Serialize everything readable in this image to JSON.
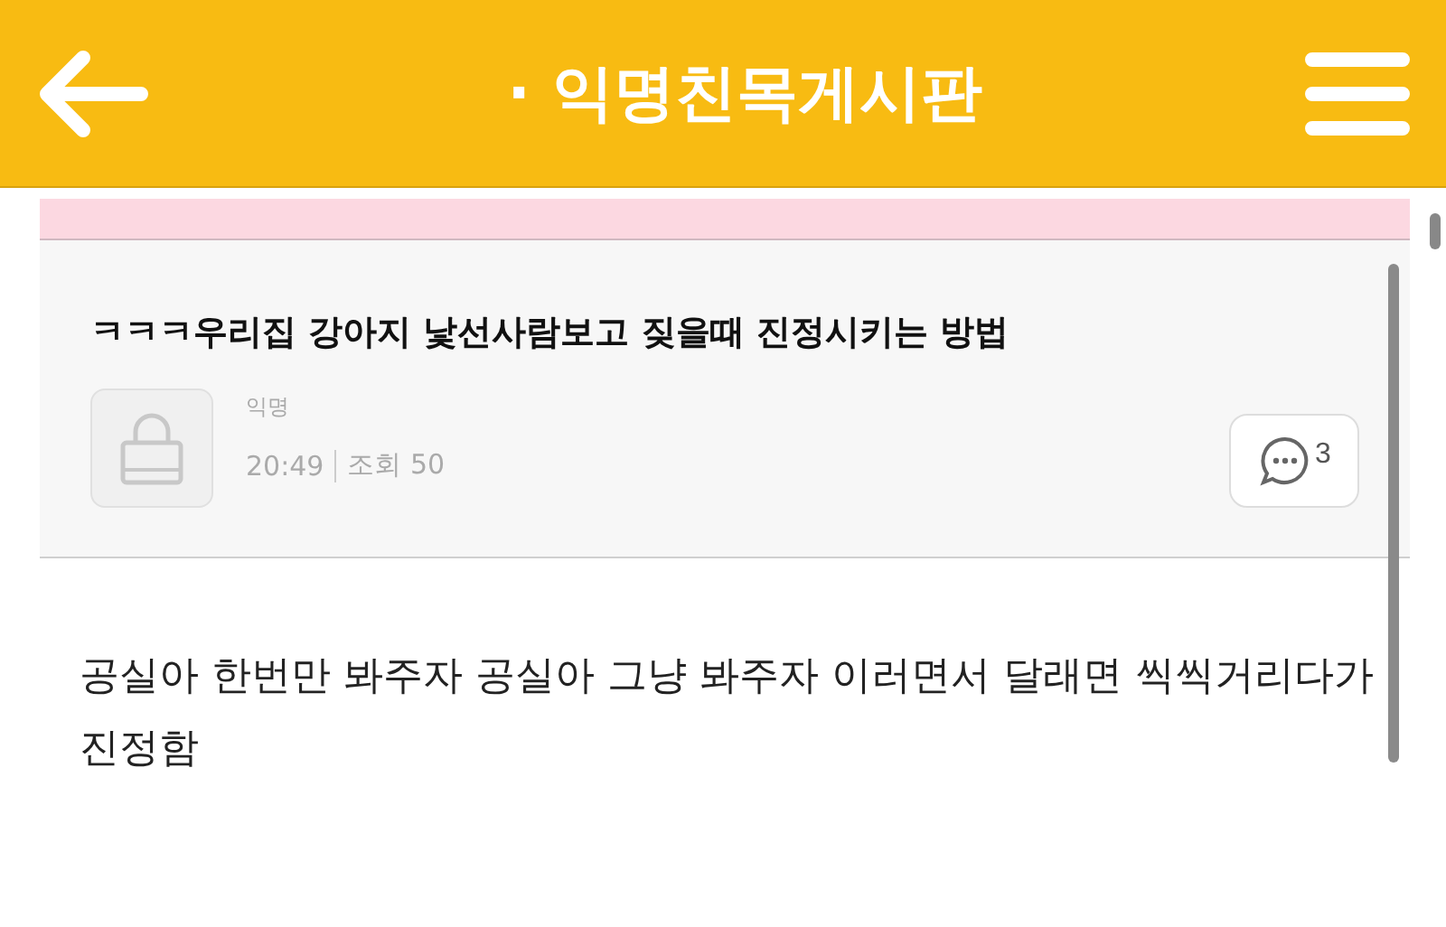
{
  "header": {
    "title": "· 익명친목게시판"
  },
  "post": {
    "title": "ㅋㅋㅋ우리집 강아지 낯선사람보고 짖을때 진정시키는 방법",
    "author": "익명",
    "time": "20:49",
    "views": "조회 50",
    "comment_count": "3"
  },
  "body": "공실아 한번만 봐주자 공실아 그냥 봐주자 이러면서 달래면 씩씩거리다가 진정함"
}
